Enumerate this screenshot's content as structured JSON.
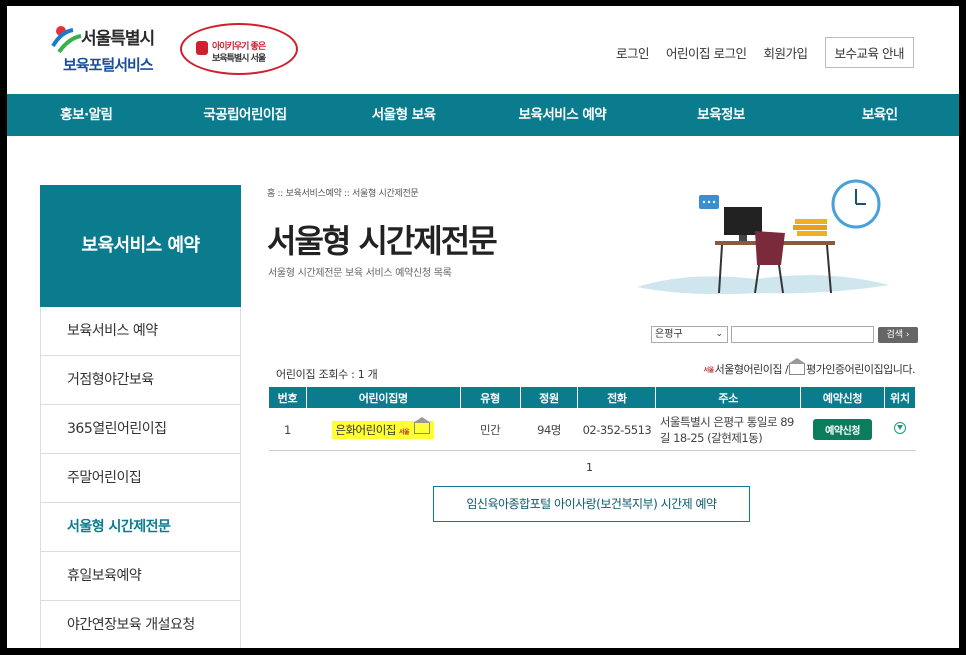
{
  "header": {
    "logo_line1": "서울특별시",
    "logo_line2": "보육포털서비스",
    "badge_line1": "아이키우기 좋은",
    "badge_line2": "보육특별시 서울"
  },
  "top_nav": {
    "login": "로그인",
    "daycare_login": "어린이집 로그인",
    "signup": "회원가입",
    "edu_info": "보수교육 안내"
  },
  "main_nav": [
    "홍보·알림",
    "국공립어린이집",
    "서울형 보육",
    "보육서비스 예약",
    "보육정보",
    "보육인"
  ],
  "sidebar": {
    "title": "보육서비스 예약",
    "items": [
      {
        "label": "보육서비스 예약"
      },
      {
        "label": "거점형야간보육"
      },
      {
        "label": "365열린어린이집"
      },
      {
        "label": "주말어린이집"
      },
      {
        "label": "서울형 시간제전문"
      },
      {
        "label": "휴일보육예약"
      },
      {
        "label": "야간연장보육 개설요청"
      }
    ],
    "active_index": 4
  },
  "content": {
    "breadcrumb": "홈 :: 보육서비스예약 :: 서울형 시간제전문",
    "title": "서울형 시간제전문",
    "subtitle": "서울형 시간제전문 보육 서비스 예약신청 목록",
    "search": {
      "district": "은평구",
      "query": "",
      "button": "검색 ›"
    },
    "count_text": "어린이집 조회수 : 1 개",
    "legend_seoul_mark": "서울",
    "legend_text_a": "서울형어린이집 /",
    "legend_text_b": "평가인증어린이집입니다.",
    "table": {
      "headers": [
        "번호",
        "어린이집명",
        "유형",
        "정원",
        "전화",
        "주소",
        "예약신청",
        "위치"
      ],
      "rows": [
        {
          "no": "1",
          "name": "은화어린이집",
          "name_mark": "서울",
          "type": "민간",
          "capacity": "94명",
          "phone": "02-352-5513",
          "address": "서울특별시 은평구 통일로 89길 18-25 (갈현제1동)",
          "reserve": "예약신청"
        }
      ]
    },
    "pager": "1",
    "external_link": "임신육아종합포털 아이사랑(보건복지부) 시간제 예약"
  },
  "colors": {
    "primary": "#0b7c8e",
    "reserve_button": "#0b7c5c",
    "highlight": "#ffff33"
  }
}
